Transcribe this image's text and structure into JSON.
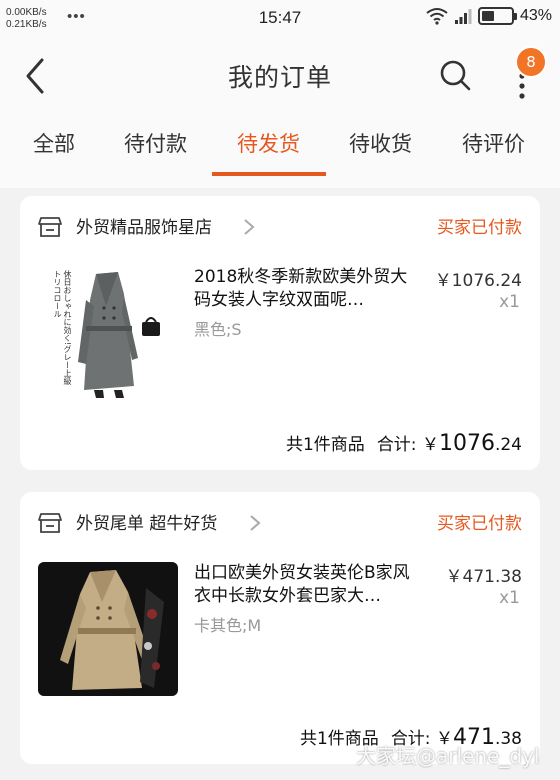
{
  "status_bar": {
    "net_up": "0.00KB/s",
    "net_down": "0.21KB/s",
    "dots": "•••",
    "time": "15:47",
    "battery_level": 0.43,
    "battery": "43%"
  },
  "header": {
    "title": "我的订单",
    "back_icon": "chevron-left-icon",
    "search_icon": "search-icon",
    "more_icon": "more-vertical-icon",
    "badge": "8"
  },
  "tabs": [
    "全部",
    "待付款",
    "待发货",
    "待收货",
    "待评价"
  ],
  "active_tab": 2,
  "colors": {
    "accent": "#e5581f",
    "badge": "#f27427"
  },
  "orders": [
    {
      "shop": "外贸精品服饰星店",
      "status": "买家已付款",
      "product": {
        "name": "2018秋冬季新款欧美外贸大码女装人字纹双面呢…",
        "spec": "黑色;S",
        "price": "￥1076.24",
        "qty": "x1",
        "image_text": "休日おしゃれに効く!グレー上級トリコロール"
      },
      "summary": {
        "count_text": "共1件商品",
        "total_label": "合计:",
        "currency": "￥",
        "total_int": "1076",
        "total_dec": ".24"
      }
    },
    {
      "shop": "外贸尾单 超牛好货",
      "status": "买家已付款",
      "product": {
        "name": "出口欧美外贸女装英伦B家风衣中长款女外套巴家大…",
        "spec": "卡其色;M",
        "price": "￥471.38",
        "qty": "x1"
      },
      "summary": {
        "count_text": "共1件商品",
        "total_label": "合计:",
        "currency": "￥",
        "total_int": "471",
        "total_dec": ".38"
      }
    }
  ],
  "watermark": "大家坛@arlene_dyl"
}
